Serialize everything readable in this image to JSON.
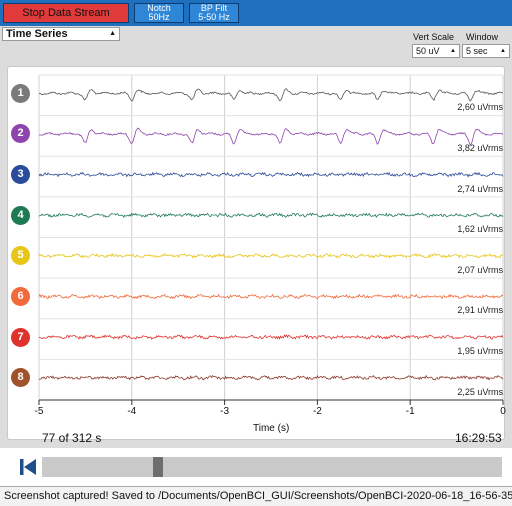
{
  "toolbar": {
    "stop_label": "Stop Data Stream",
    "notch_line1": "Notch",
    "notch_line2": "50Hz",
    "bp_line1": "BP Filt",
    "bp_line2": "5-50 Hz"
  },
  "widget": {
    "selected": "Time Series",
    "vert_scale_label": "Vert Scale",
    "vert_scale_value": "50 uV",
    "window_label": "Window",
    "window_value": "5 sec"
  },
  "channels": [
    {
      "number": "1",
      "rms": "2,60 uVrms",
      "color": "#7a7a7a",
      "trace": "#555555"
    },
    {
      "number": "2",
      "rms": "3,82 uVrms",
      "color": "#8e44ad",
      "trace": "#8e44ad"
    },
    {
      "number": "3",
      "rms": "2,74 uVrms",
      "color": "#2b4c9a",
      "trace": "#2b4c9a"
    },
    {
      "number": "4",
      "rms": "1,62 uVrms",
      "color": "#1e7a53",
      "trace": "#1e7a53"
    },
    {
      "number": "5",
      "rms": "2,07 uVrms",
      "color": "#e6c619",
      "trace": "#e6c619"
    },
    {
      "number": "6",
      "rms": "2,91 uVrms",
      "color": "#f26a3a",
      "trace": "#f26a3a"
    },
    {
      "number": "7",
      "rms": "1,95 uVrms",
      "color": "#e0322d",
      "trace": "#e0322d"
    },
    {
      "number": "8",
      "rms": "2,25 uVrms",
      "color": "#a0522d",
      "trace": "#8b3a2a"
    }
  ],
  "axis": {
    "ticks": [
      "-5",
      "-4",
      "-3",
      "-2",
      "-1",
      "0"
    ],
    "label": "Time (s)"
  },
  "playback": {
    "position_text": "77 of 312 s",
    "clock": "16:29:53",
    "progress": 0.2468
  },
  "status": {
    "message": "Screenshot captured! Saved to /Documents/OpenBCI_GUI/Screenshots/OpenBCI-2020-06-18_16-56-35"
  }
}
